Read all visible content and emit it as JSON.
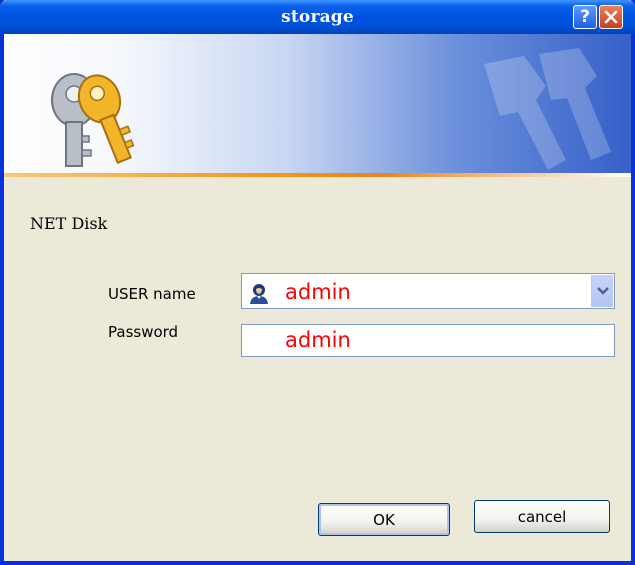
{
  "window": {
    "title": "storage",
    "help_glyph": "?",
    "icons": {
      "help": "help-icon",
      "close": "close-icon",
      "banner": "keys-icon",
      "user": "user-icon",
      "dropdown": "chevron-down-icon"
    }
  },
  "dialog": {
    "app_label": "NET Disk",
    "username_label": "USER name",
    "username_value": "admin",
    "password_label": "Password",
    "password_value": "admin"
  },
  "buttons": {
    "ok_label": "OK",
    "cancel_label": "cancel"
  },
  "colors": {
    "title_bar": "#0053e1",
    "value_text": "#ff0000",
    "accent_line": "#f49a20"
  }
}
